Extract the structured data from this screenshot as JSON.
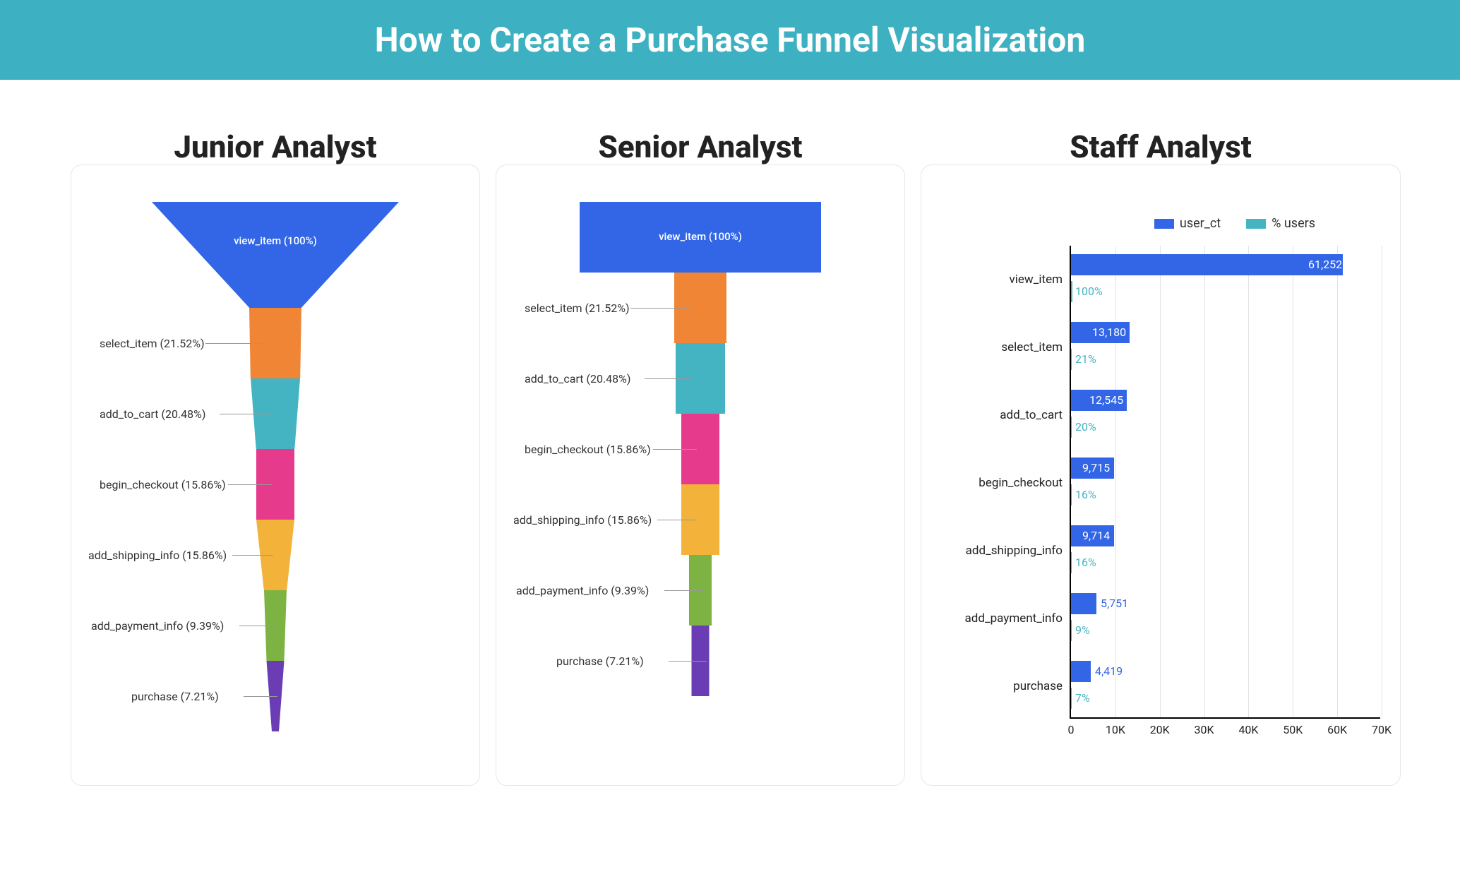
{
  "header": {
    "title": "How to Create a Purchase Funnel Visualization"
  },
  "panels": {
    "junior": {
      "title": "Junior Analyst"
    },
    "senior": {
      "title": "Senior Analyst"
    },
    "staff": {
      "title": "Staff Analyst"
    }
  },
  "colors": {
    "blue": "#3366e6",
    "orange": "#ef8535",
    "teal": "#45b4c2",
    "pink": "#e63a8d",
    "amber": "#f3b23a",
    "green": "#7cb342",
    "purple": "#6a3db5",
    "legend_teal": "#45b4c2",
    "text_ct": "#3366e6",
    "text_pct": "#45b4c2"
  },
  "funnel_labels": {
    "view_item": "view_item (100%)",
    "select_item": "select_item (21.52%)",
    "add_to_cart": "add_to_cart (20.48%)",
    "begin_checkout": "begin_checkout (15.86%)",
    "add_shipping_info": "add_shipping_info (15.86%)",
    "add_payment_info": "add_payment_info (9.39%)",
    "purchase": "purchase (7.21%)"
  },
  "staff_legend": {
    "series1": "user_ct",
    "series2": "% users"
  },
  "staff_rows": {
    "r0": {
      "label": "view_item",
      "ct": "61,252",
      "pct": "100%"
    },
    "r1": {
      "label": "select_item",
      "ct": "13,180",
      "pct": "21%"
    },
    "r2": {
      "label": "add_to_cart",
      "ct": "12,545",
      "pct": "20%"
    },
    "r3": {
      "label": "begin_checkout",
      "ct": "9,715",
      "pct": "16%"
    },
    "r4": {
      "label": "add_shipping_info",
      "ct": "9,714",
      "pct": "16%"
    },
    "r5": {
      "label": "add_payment_info",
      "ct": "5,751",
      "pct": "9%"
    },
    "r6": {
      "label": "purchase",
      "ct": "4,419",
      "pct": "7%"
    }
  },
  "x_ticks": {
    "t0": "0",
    "t1": "10K",
    "t2": "20K",
    "t3": "30K",
    "t4": "40K",
    "t5": "50K",
    "t6": "60K",
    "t7": "70K"
  },
  "chart_data": [
    {
      "type": "funnel",
      "title": "Junior Analyst",
      "style": "smooth/tapered",
      "stages": [
        {
          "name": "view_item",
          "pct": 100.0,
          "color": "#3366e6"
        },
        {
          "name": "select_item",
          "pct": 21.52,
          "color": "#ef8535"
        },
        {
          "name": "add_to_cart",
          "pct": 20.48,
          "color": "#45b4c2"
        },
        {
          "name": "begin_checkout",
          "pct": 15.86,
          "color": "#e63a8d"
        },
        {
          "name": "add_shipping_info",
          "pct": 15.86,
          "color": "#f3b23a"
        },
        {
          "name": "add_payment_info",
          "pct": 9.39,
          "color": "#7cb342"
        },
        {
          "name": "purchase",
          "pct": 7.21,
          "color": "#6a3db5"
        }
      ]
    },
    {
      "type": "funnel",
      "title": "Senior Analyst",
      "style": "stepped bar funnel",
      "stages": [
        {
          "name": "view_item",
          "pct": 100.0,
          "color": "#3366e6"
        },
        {
          "name": "select_item",
          "pct": 21.52,
          "color": "#ef8535"
        },
        {
          "name": "add_to_cart",
          "pct": 20.48,
          "color": "#45b4c2"
        },
        {
          "name": "begin_checkout",
          "pct": 15.86,
          "color": "#e63a8d"
        },
        {
          "name": "add_shipping_info",
          "pct": 15.86,
          "color": "#f3b23a"
        },
        {
          "name": "add_payment_info",
          "pct": 9.39,
          "color": "#7cb342"
        },
        {
          "name": "purchase",
          "pct": 7.21,
          "color": "#6a3db5"
        }
      ]
    },
    {
      "type": "bar",
      "orientation": "horizontal",
      "title": "Staff Analyst",
      "x_axis": {
        "label": "",
        "min": 0,
        "max": 70000,
        "ticks": [
          0,
          10000,
          20000,
          30000,
          40000,
          50000,
          60000,
          70000
        ],
        "tick_labels": [
          "0",
          "10K",
          "20K",
          "30K",
          "40K",
          "50K",
          "60K",
          "70K"
        ]
      },
      "categories": [
        "view_item",
        "select_item",
        "add_to_cart",
        "begin_checkout",
        "add_shipping_info",
        "add_payment_info",
        "purchase"
      ],
      "series": [
        {
          "name": "user_ct",
          "color": "#3366e6",
          "values": [
            61252,
            13180,
            12545,
            9715,
            9714,
            5751,
            4419
          ]
        },
        {
          "name": "% users",
          "color": "#45b4c2",
          "values": [
            100,
            21,
            20,
            16,
            16,
            9,
            7
          ]
        }
      ],
      "legend_position": "top-right"
    }
  ]
}
